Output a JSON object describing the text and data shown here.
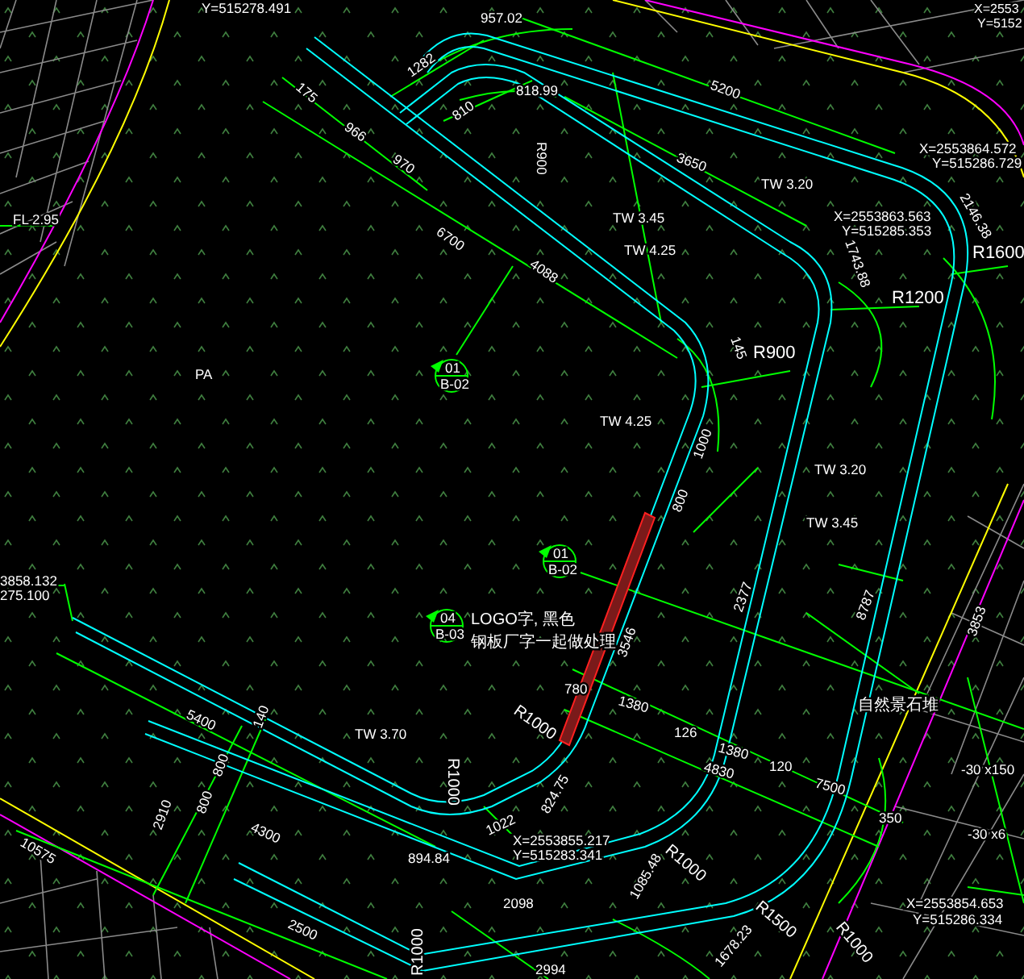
{
  "drawing": {
    "labels": [
      {
        "text": "Y=515278.491"
      },
      {
        "text": "957.02"
      },
      {
        "text": "X=2553"
      },
      {
        "text": "Y=5152"
      },
      {
        "text": "1282"
      },
      {
        "text": "818.99"
      },
      {
        "text": "5200"
      },
      {
        "text": "175"
      },
      {
        "text": "966"
      },
      {
        "text": "810"
      },
      {
        "text": "970"
      },
      {
        "text": "R900"
      },
      {
        "text": "3650"
      },
      {
        "text": "X=2553864.572"
      },
      {
        "text": "Y=515286.729"
      },
      {
        "text": "TW 3.20"
      },
      {
        "text": "TW 3.45"
      },
      {
        "text": "X=2553863.563"
      },
      {
        "text": "Y=515285.353"
      },
      {
        "text": "2146.38"
      },
      {
        "text": "R1600"
      },
      {
        "text": "6700"
      },
      {
        "text": "TW 4.25"
      },
      {
        "text": "4088"
      },
      {
        "text": "1743.88"
      },
      {
        "text": "R1200"
      },
      {
        "text": "PA"
      },
      {
        "text": "FL 2.95"
      },
      {
        "text": "145"
      },
      {
        "text": "R900"
      },
      {
        "text": "TW 4.25"
      },
      {
        "text": "1000"
      },
      {
        "text": "TW 3.20"
      },
      {
        "text": "800"
      },
      {
        "text": "TW 3.45"
      },
      {
        "text": "2377"
      },
      {
        "text": "8787"
      },
      {
        "text": "3853"
      },
      {
        "text": "3858.132"
      },
      {
        "text": "275.100"
      },
      {
        "text": "LOGO字, 黑色"
      },
      {
        "text": "钢板厂字一起做处理"
      },
      {
        "text": "3546"
      },
      {
        "text": "780"
      },
      {
        "text": "R1000"
      },
      {
        "text": "1380"
      },
      {
        "text": "126"
      },
      {
        "text": "1380"
      },
      {
        "text": "4830"
      },
      {
        "text": "120"
      },
      {
        "text": "7500"
      },
      {
        "text": "自然景石堆"
      },
      {
        "text": "350"
      },
      {
        "text": "-30 x150"
      },
      {
        "text": "-30 x6"
      },
      {
        "text": "5400"
      },
      {
        "text": "140"
      },
      {
        "text": "TW 3.70"
      },
      {
        "text": "R1000"
      },
      {
        "text": "2910"
      },
      {
        "text": "800"
      },
      {
        "text": "800"
      },
      {
        "text": "4300"
      },
      {
        "text": "1022"
      },
      {
        "text": "894.84"
      },
      {
        "text": "824.75"
      },
      {
        "text": "X=2553855.217"
      },
      {
        "text": "Y=515283.341"
      },
      {
        "text": "10575"
      },
      {
        "text": "2098"
      },
      {
        "text": "1085.48"
      },
      {
        "text": "R1000"
      },
      {
        "text": "2500"
      },
      {
        "text": "R1000"
      },
      {
        "text": "X=2553854.653"
      },
      {
        "text": "Y=515286.334"
      },
      {
        "text": "R1500"
      },
      {
        "text": "1678.23"
      },
      {
        "text": "2994"
      },
      {
        "text": "R1000"
      }
    ],
    "section_marks": [
      {
        "number": "01",
        "sheet": "B-02"
      },
      {
        "number": "01",
        "sheet": "B-02"
      },
      {
        "number": "04",
        "sheet": "B-03"
      }
    ]
  }
}
